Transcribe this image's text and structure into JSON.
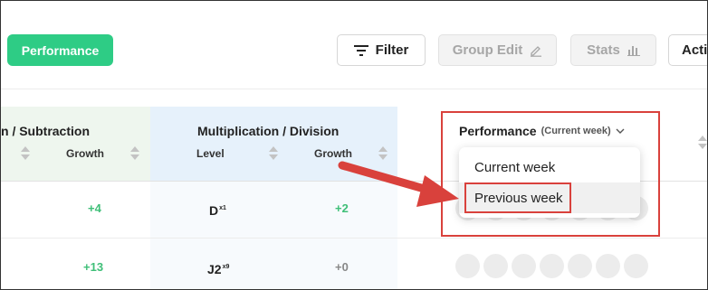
{
  "toolbar": {
    "performance_tab": "Performance",
    "filter_label": "Filter",
    "group_edit_label": "Group Edit",
    "stats_label": "Stats",
    "actions_label": "Acti"
  },
  "table": {
    "groups": {
      "add_sub": "n / Subtraction",
      "mult_div": "Multiplication / Division",
      "performance": "Performance",
      "performance_period": "(Current week)"
    },
    "subheaders": {
      "add_sub_growth": "Growth",
      "mult_level": "Level",
      "mult_growth": "Growth"
    },
    "rows": [
      {
        "add_sub_growth": "+4",
        "mult_level": "D",
        "mult_level_sup": "x1",
        "mult_growth": "+2"
      },
      {
        "add_sub_growth": "+13",
        "mult_level": "J2",
        "mult_level_sup": "x9",
        "mult_growth": "+0"
      }
    ]
  },
  "dropdown": {
    "options": [
      "Current week",
      "Previous week"
    ],
    "highlighted_index": 1
  },
  "colors": {
    "accent_green": "#2ecc85",
    "growth_green": "#3fbf78",
    "annotation_red": "#d9413c"
  }
}
